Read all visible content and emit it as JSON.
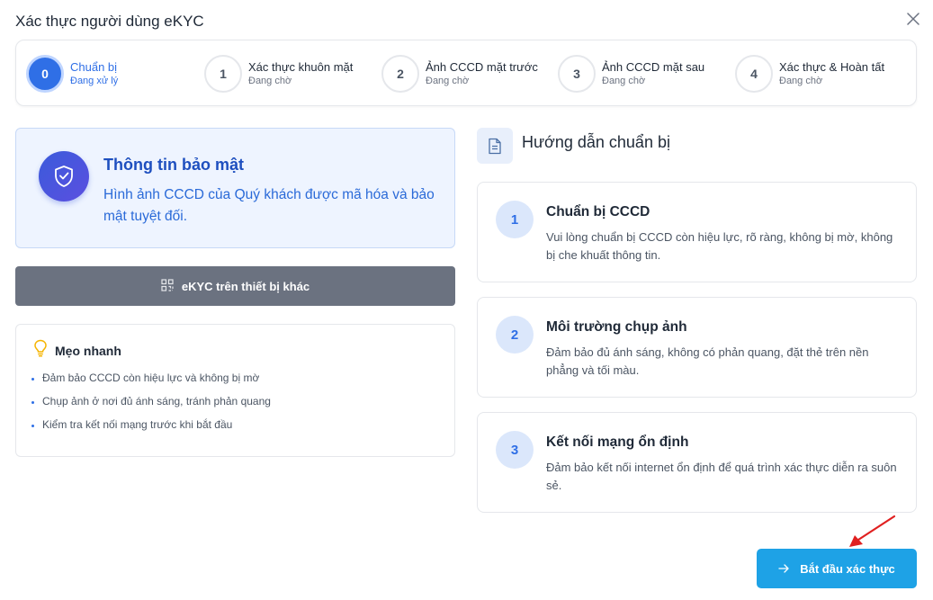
{
  "dialog": {
    "title": "Xác thực người dùng eKYC"
  },
  "steps": [
    {
      "number": "0",
      "label": "Chuẩn bị",
      "status": "Đang xử lý",
      "active": true
    },
    {
      "number": "1",
      "label": "Xác thực khuôn mặt",
      "status": "Đang chờ",
      "active": false
    },
    {
      "number": "2",
      "label": "Ảnh CCCD mặt trước",
      "status": "Đang chờ",
      "active": false
    },
    {
      "number": "3",
      "label": "Ảnh CCCD mặt sau",
      "status": "Đang chờ",
      "active": false
    },
    {
      "number": "4",
      "label": "Xác thực & Hoàn tất",
      "status": "Đang chờ",
      "active": false
    }
  ],
  "security": {
    "title": "Thông tin bảo mật",
    "description": "Hình ảnh CCCD của Quý khách được mã hóa và bảo mật tuyệt đối.",
    "icon": "shield-check-icon"
  },
  "other_device_button": {
    "label": "eKYC trên thiết bị khác",
    "icon": "qr-code-icon"
  },
  "tips": {
    "title": "Mẹo nhanh",
    "icon": "lightbulb-icon",
    "items": [
      "Đảm bảo CCCD còn hiệu lực và không bị mờ",
      "Chụp ảnh ở nơi đủ ánh sáng, tránh phản quang",
      "Kiểm tra kết nối mạng trước khi bắt đầu"
    ]
  },
  "guide": {
    "title": "Hướng dẫn chuẩn bị",
    "icon": "document-icon",
    "cards": [
      {
        "number": "1",
        "title": "Chuẩn bị CCCD",
        "description": "Vui lòng chuẩn bị CCCD còn hiệu lực, rõ ràng, không bị mờ, không bị che khuất thông tin."
      },
      {
        "number": "2",
        "title": "Môi trường chụp ảnh",
        "description": "Đảm bảo đủ ánh sáng, không có phản quang, đặt thẻ trên nền phẳng và tối màu."
      },
      {
        "number": "3",
        "title": "Kết nối mạng ổn định",
        "description": "Đảm bảo kết nối internet ổn định để quá trình xác thực diễn ra suôn sẻ."
      }
    ]
  },
  "start_button": {
    "label": "Bắt đầu xác thực",
    "icon": "arrow-right-icon"
  },
  "colors": {
    "primary": "#2f6fe6",
    "start_button": "#1ea2e6",
    "secondary_button": "#6b7280",
    "annotation": "#e02020"
  }
}
